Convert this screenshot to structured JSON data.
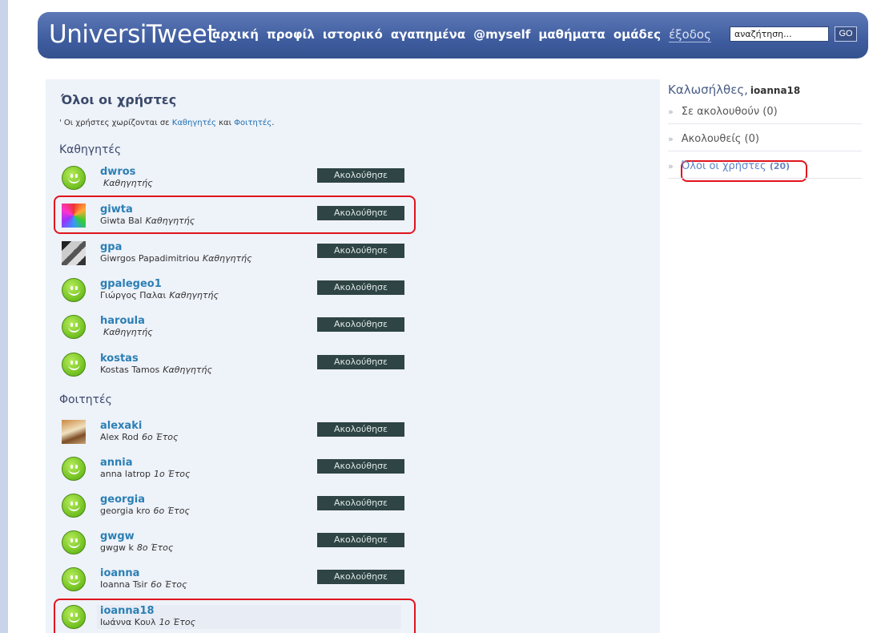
{
  "header": {
    "logo": "UniversiTweet",
    "nav": [
      "αρχική",
      "προφίλ",
      "ιστορικό",
      "αγαπημένα",
      "@myself",
      "μαθήματα",
      "ομάδες"
    ],
    "logout": "έξοδος",
    "search_value": "αναζήτηση...",
    "go_label": "GO"
  },
  "main": {
    "title": "Όλοι οι χρήστες",
    "note_prefix": "' Οι χρήστες χωρίζονται σε ",
    "note_link1": "Καθηγητές",
    "note_mid": " και ",
    "note_link2": "Φοιτητές",
    "note_suffix": ".",
    "section_teachers": "Καθηγητές",
    "section_students": "Φοιτητές",
    "follow_label": "Ακολούθησε",
    "teachers": [
      {
        "username": "dwros",
        "fullname": "",
        "role": "Καθηγητής",
        "avatar": "smiley-icon"
      },
      {
        "username": "giwta",
        "fullname": "Giwta Bal",
        "role": "Καθηγητής",
        "avatar": "photo-psychedelic"
      },
      {
        "username": "gpa",
        "fullname": "Giwrgos Papadimitriou",
        "role": "Καθηγητής",
        "avatar": "photo-bw"
      },
      {
        "username": "gpalegeo1",
        "fullname": "Γιώργος Παλαι",
        "role": "Καθηγητής",
        "avatar": "smiley-icon"
      },
      {
        "username": "haroula",
        "fullname": "",
        "role": "Καθηγητής",
        "avatar": "smiley-icon"
      },
      {
        "username": "kostas",
        "fullname": "Kostas Tamos",
        "role": "Καθηγητής",
        "avatar": "smiley-icon"
      }
    ],
    "students": [
      {
        "username": "alexaki",
        "fullname": "Alex Rod",
        "role": "6ο Έτος",
        "avatar": "photo-warm"
      },
      {
        "username": "annia",
        "fullname": "anna latrop",
        "role": "1ο Έτος",
        "avatar": "smiley-icon"
      },
      {
        "username": "georgia",
        "fullname": "georgia kro",
        "role": "6ο Έτος",
        "avatar": "smiley-icon"
      },
      {
        "username": "gwgw",
        "fullname": "gwgw k",
        "role": "8ο Έτος",
        "avatar": "smiley-icon"
      },
      {
        "username": "ioanna",
        "fullname": "Ioanna Tsir",
        "role": "6ο Έτος",
        "avatar": "smiley-icon"
      },
      {
        "username": "ioanna18",
        "fullname": "Ιωάννα Κουλ",
        "role": "1ο Έτος",
        "avatar": "smiley-icon"
      }
    ]
  },
  "sidebar": {
    "welcome": "Καλωσήλθες,",
    "user": "ioanna18",
    "items": [
      {
        "label": "Σε ακολουθούν (0)",
        "count": ""
      },
      {
        "label": "Ακολουθείς (0)",
        "count": ""
      },
      {
        "label": "Όλοι οι χρήστες",
        "count": "(20)"
      }
    ]
  },
  "colors": {
    "header": "#3f5d9f",
    "follow_button": "#2f4444",
    "link": "#2b7fb5",
    "highlight": "#e0141e"
  }
}
